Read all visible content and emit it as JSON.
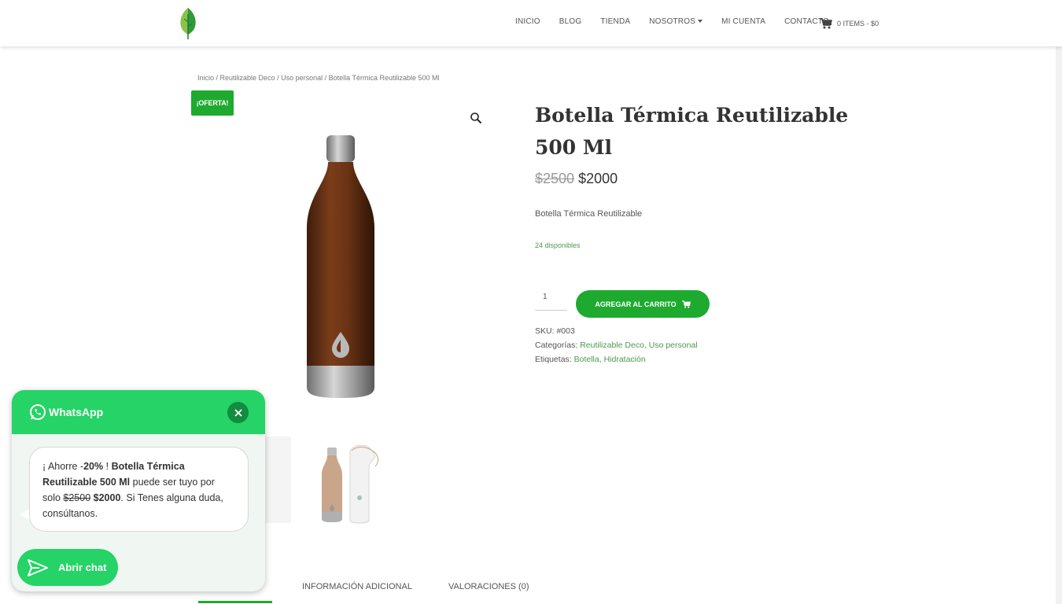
{
  "header": {
    "nav": [
      {
        "label": "INICIO"
      },
      {
        "label": "BLOG"
      },
      {
        "label": "TIENDA"
      },
      {
        "label": "NOSOTROS"
      },
      {
        "label": "MI CUENTA"
      },
      {
        "label": "CONTACTO"
      }
    ],
    "cart_label": "0 ITEMS - $0"
  },
  "breadcrumb": {
    "items": [
      "Inicio",
      "Reutilizable Deco",
      "Uso personal",
      "Botella Térmica Reutilizable 500 Ml"
    ],
    "separator": " / "
  },
  "product": {
    "sale_badge": "¡OFERTA!",
    "title": "Botella Térmica Reutilizable 500 Ml",
    "price_old": "$2500",
    "price_new": "$2000",
    "short_description": "Botella Térmica Reutilizable",
    "stock": "24 disponibles",
    "quantity": "1",
    "add_to_cart": "AGREGAR AL CARRITO",
    "sku_label": "SKU:",
    "sku": "#003",
    "categories_label": "Categorías:",
    "categories": "Reutilizable Deco, Uso personal",
    "tags_label": "Etiquetas:",
    "tags": "Botella, Hidratación"
  },
  "tabs": [
    {
      "label": "DESCRIPCIÓN",
      "visible_label": "ÓN"
    },
    {
      "label": "INFORMACIÓN ADICIONAL"
    },
    {
      "label": "VALORACIONES (0)"
    }
  ],
  "whatsapp": {
    "title": "WhatsApp",
    "msg_prefix": "¡ Ahorre -",
    "msg_discount": "20%",
    "msg_mid1": " ! ",
    "msg_product": "Botella Térmica Reutilizable 500 Ml",
    "msg_mid2": " puede ser tuyo por solo ",
    "msg_old_price": "$2500",
    "msg_new_price": "$2000",
    "msg_suffix": ". Si Tenes alguna duda, consúltanos.",
    "open_chat": "Abrir chat"
  },
  "colors": {
    "accent_green": "#1eaa2f",
    "whatsapp_green": "#25d366",
    "link_green": "#4c9a4c"
  }
}
